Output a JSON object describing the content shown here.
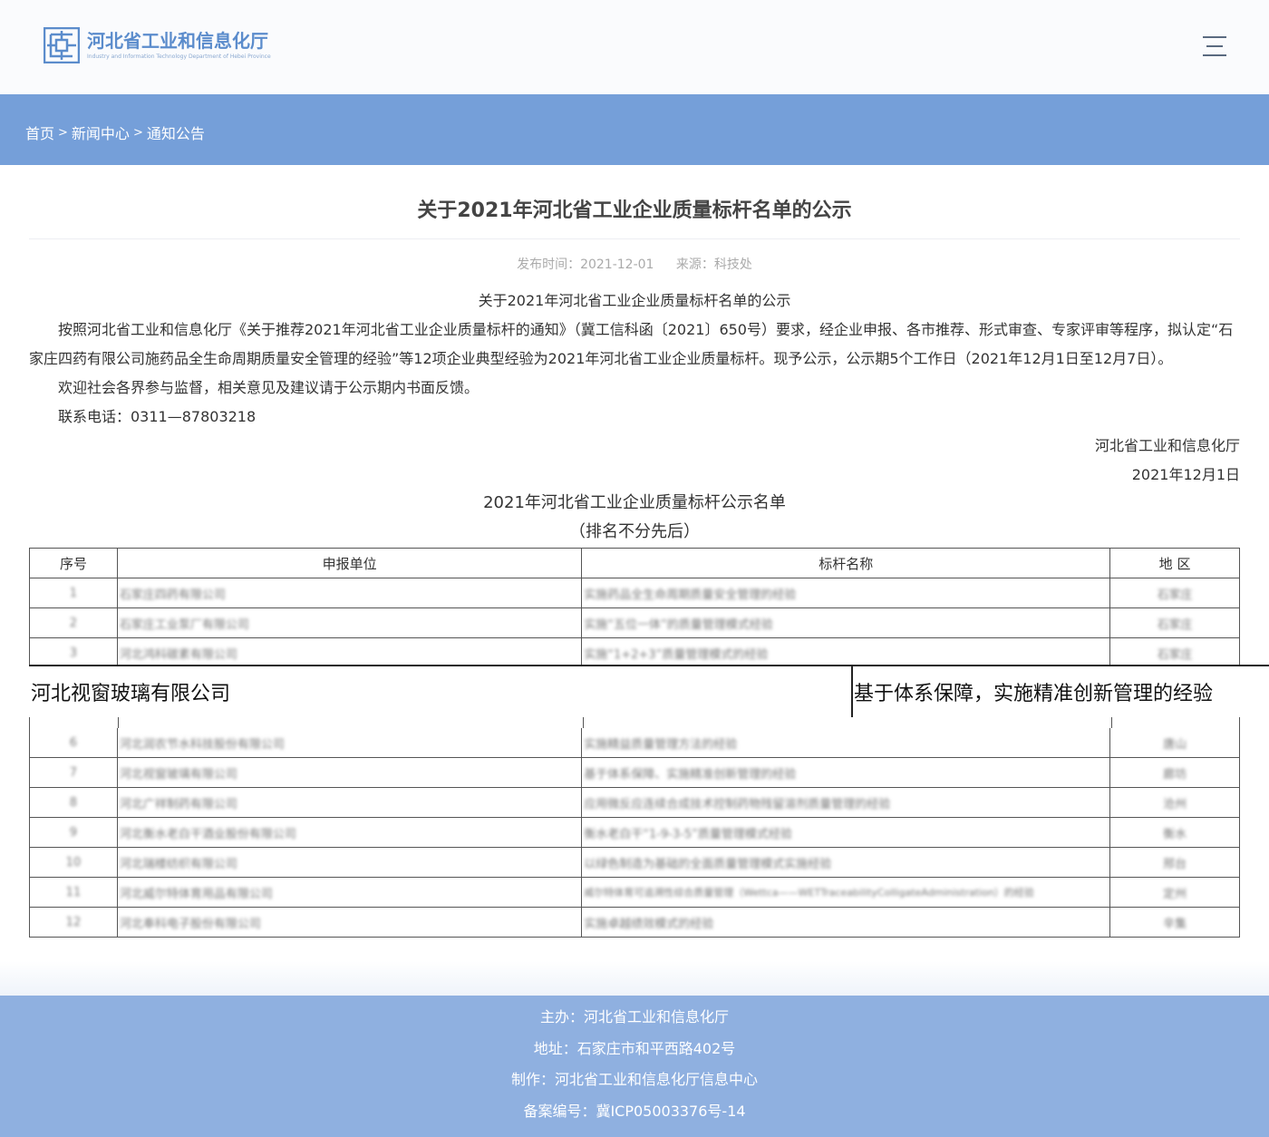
{
  "header": {
    "logo_cn": "河北省工业和信息化厅",
    "logo_en": "Industry and Information Technology Department of Hebei Province",
    "menu_icon": "hamburger-menu-icon"
  },
  "breadcrumb": {
    "home": "首页",
    "news": "新闻中心",
    "notice": "通知公告",
    "sep": ">"
  },
  "article": {
    "title": "关于2021年河北省工业企业质量标杆名单的公示",
    "publish_time": "发布时间：2021-12-01",
    "source": "来源：科技处",
    "sub_title": "关于2021年河北省工业企业质量标杆名单的公示",
    "para1": "按照河北省工业和信息化厅《关于推荐2021年河北省工业企业质量标杆的通知》（冀工信科函〔2021〕650号）要求，经企业申报、各市推荐、形式审查、专家评审等程序，拟认定“石家庄四药有限公司施药品全生命周期质量安全管理的经验”等12项企业典型经验为2021年河北省工业企业质量标杆。现予公示，公示期5个工作日（2021年12月1日至12月7日）。",
    "para2": "欢迎社会各界参与监督，相关意见及建议请于公示期内书面反馈。",
    "para3": "联系电话：0311—87803218",
    "signature": "河北省工业和信息化厅",
    "date": "2021年12月1日",
    "table_title": "2021年河北省工业企业质量标杆公示名单",
    "table_subtitle": "（排名不分先后）"
  },
  "table": {
    "headers": [
      "序号",
      "申报单位",
      "标杆名称",
      "地 区"
    ],
    "rows": [
      [
        "1",
        "石家庄四药有限公司",
        "实施药品全生命周期质量安全管理的经验",
        "石家庄"
      ],
      [
        "2",
        "石家庄工业泵厂有限公司",
        "实施“五位一体”的质量管理模式经验",
        "石家庄"
      ],
      [
        "3",
        "河北鸿科碳素有限公司",
        "实施“1+2+3”质量管理模式的经验",
        "石家庄"
      ],
      [
        "6",
        "河北润农节水科技股份有限公司",
        "实施精益质量管理方法的经验",
        "唐山"
      ],
      [
        "7",
        "河北视窗玻璃有限公司",
        "基于体系保障、实施精准创新管理的经验",
        "廊坊"
      ],
      [
        "8",
        "河北广祥制药有限公司",
        "应用微反应连续合成技术控制药物残留溶剂质量管理的经验",
        "沧州"
      ],
      [
        "9",
        "河北衡水老白干酒业股份有限公司",
        "衡水老白干“1-9-3-5”质量管理模式经验",
        "衡水"
      ],
      [
        "10",
        "河北瑞楼纺织有限公司",
        "以绿色制造为基础的全面质量管理模式实施经验",
        "邢台"
      ],
      [
        "11",
        "河北威尔特体育用品有限公司",
        "威尔特体育可追溯性综合质量管理（Wettca——WETTraceabilityColligateAdministration）的经验",
        "定州"
      ],
      [
        "12",
        "河北奉科电子股份有限公司",
        "实施卓越绩效模式的经验",
        "辛集"
      ]
    ]
  },
  "overlay": {
    "company": "河北视窗玻璃有限公司",
    "benchmark": "基于体系保障，实施精准创新管理的经验"
  },
  "footer": {
    "host": "主办：河北省工业和信息化厅",
    "address": "地址：石家庄市和平西路402号",
    "maker": "制作：河北省工业和信息化厅信息中心",
    "icp": "备案编号：冀ICP05003376号-14"
  }
}
